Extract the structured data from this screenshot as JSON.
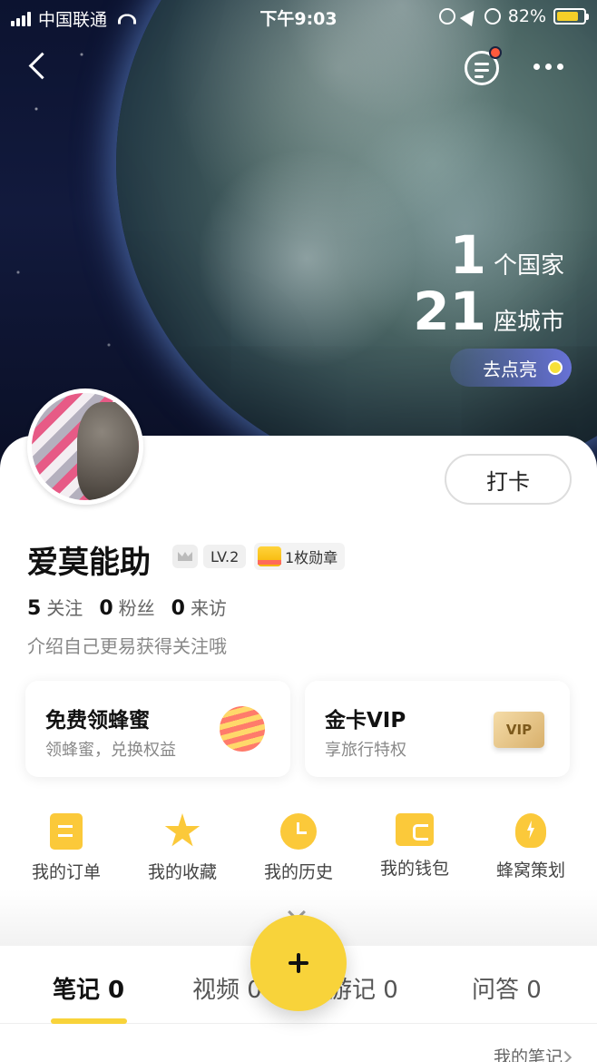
{
  "status_bar": {
    "carrier": "中国联通",
    "time": "下午9:03",
    "battery_percent": "82%",
    "battery_level": 0.82
  },
  "hero": {
    "countries_count": "1",
    "countries_unit": "个国家",
    "cities_count": "21",
    "cities_unit": "座城市",
    "light_up_label": "去点亮"
  },
  "profile": {
    "checkin_label": "打卡",
    "username": "爱莫能助",
    "level": "LV.2",
    "medals": "1枚勋章",
    "following_count": "5",
    "following_label": "关注",
    "followers_count": "0",
    "followers_label": "粉丝",
    "visitors_count": "0",
    "visitors_label": "来访",
    "bio": "介绍自己更易获得关注哦"
  },
  "promos": [
    {
      "title": "免费领蜂蜜",
      "subtitle": "领蜂蜜，兑换权益",
      "icon": "honey-jar-icon"
    },
    {
      "title": "金卡VIP",
      "subtitle": "享旅行特权",
      "icon_text": "VIP"
    }
  ],
  "quick_links": [
    {
      "label": "我的订单",
      "icon": "order-icon"
    },
    {
      "label": "我的收藏",
      "icon": "star-icon"
    },
    {
      "label": "我的历史",
      "icon": "clock-icon"
    },
    {
      "label": "我的钱包",
      "icon": "wallet-icon"
    },
    {
      "label": "蜂窝策划",
      "icon": "bulb-icon"
    }
  ],
  "tabs": [
    {
      "label": "笔记 0",
      "active": true
    },
    {
      "label": "视频 0",
      "active": false
    },
    {
      "label": "游记 0",
      "active": false
    },
    {
      "label": "问答 0",
      "active": false
    }
  ],
  "my_notes_link": "我的笔记",
  "colors": {
    "accent": "#f8d33a",
    "icon_yellow": "#fbc93a"
  }
}
